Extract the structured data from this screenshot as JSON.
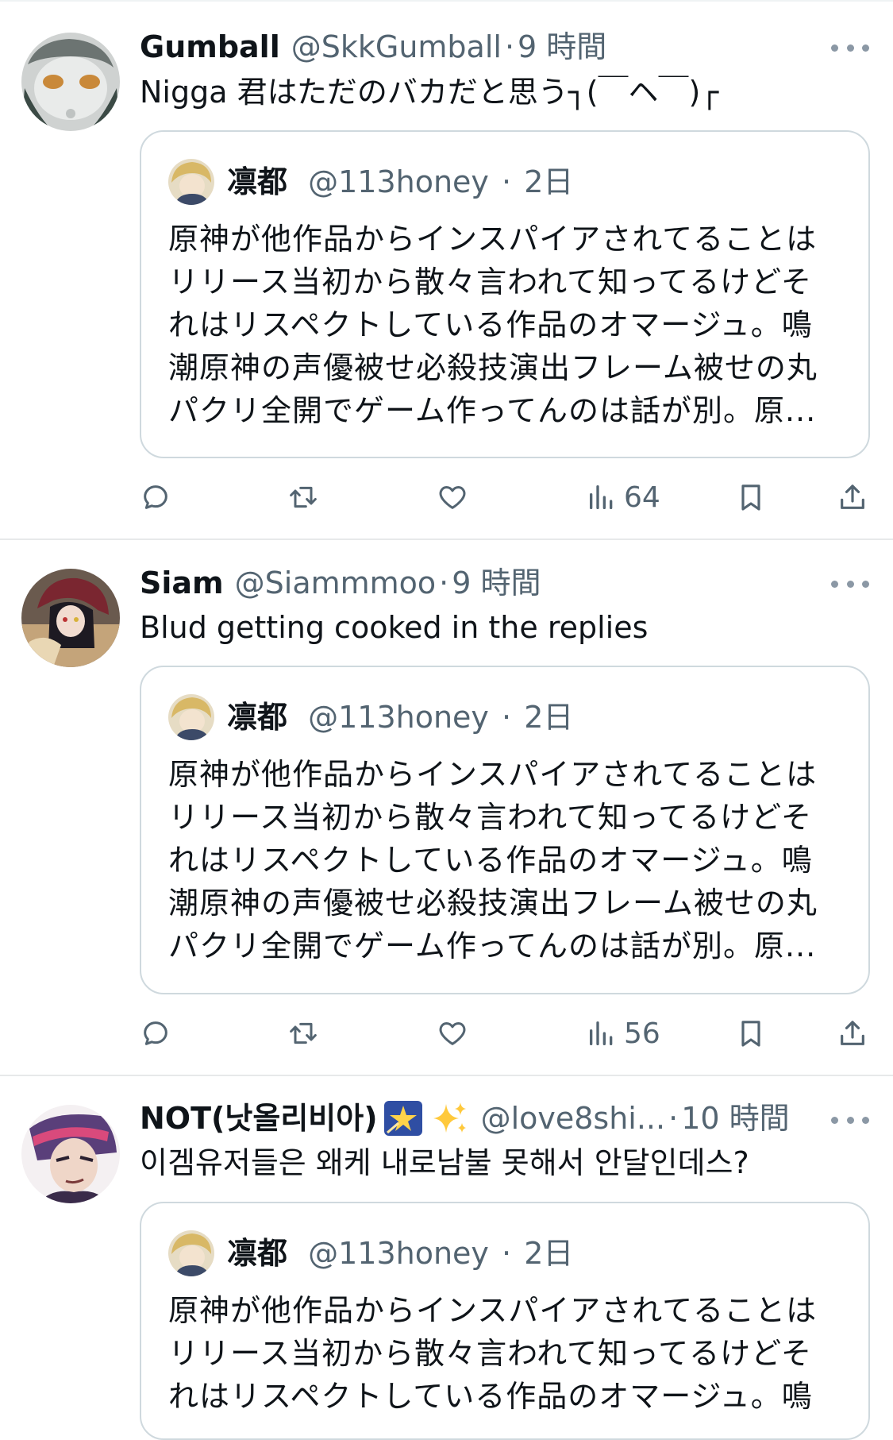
{
  "tweets": [
    {
      "name": "Gumball",
      "handle": "@SkkGumball",
      "sep": "·",
      "time": "9 時間",
      "text": "Nigga 君はただのバカだと思う┐(￣ヘ￣)┌",
      "quote": {
        "name": "凛都",
        "handle": "@113honey",
        "sep": "·",
        "time": "2日",
        "lines": [
          "原神が他作品からインスパイアされてることは",
          "リリース当初から散々言われて知ってるけどそ",
          "れはリスペクトしている作品のオマージュ。鳴",
          "潮原神の声優被せ必殺技演出フレーム被せの丸",
          "パクリ全開でゲーム作ってんのは話が別。原..."
        ]
      },
      "views": "64"
    },
    {
      "name": "Siam",
      "handle": "@Siammmoo",
      "sep": "·",
      "time": "9 時間",
      "text": "Blud getting cooked in the replies",
      "quote": {
        "name": "凛都",
        "handle": "@113honey",
        "sep": "·",
        "time": "2日",
        "lines": [
          "原神が他作品からインスパイアされてることは",
          "リリース当初から散々言われて知ってるけどそ",
          "れはリスペクトしている作品のオマージュ。鳴",
          "潮原神の声優被せ必殺技演出フレーム被せの丸",
          "パクリ全開でゲーム作ってんのは話が別。原..."
        ]
      },
      "views": "56"
    },
    {
      "name": "NOT(낫올리비아)",
      "handle": "@love8shi...",
      "sep": "·",
      "time": "10 時間",
      "text": "이겜유저들은 왜케 내로남불 못해서 안달인데스?",
      "name_emojis": [
        "night-sky-star-emoji",
        "sparkles-emoji"
      ],
      "quote": {
        "name": "凛都",
        "handle": "@113honey",
        "sep": "·",
        "time": "2日",
        "lines": [
          "原神が他作品からインスパイアされてることは",
          "リリース当初から散々言われて知ってるけどそ",
          "れはリスペクトしている作品のオマージュ。鳴"
        ]
      }
    }
  ],
  "icons": {
    "reply": "reply-icon",
    "retweet": "retweet-icon",
    "like": "heart-icon",
    "views": "views-icon",
    "bookmark": "bookmark-icon",
    "share": "share-icon",
    "more": "more-icon"
  },
  "colors": {
    "text": "#0f1419",
    "secondary": "#536471",
    "border": "#cfd9de",
    "divider": "#e7e9ea"
  }
}
